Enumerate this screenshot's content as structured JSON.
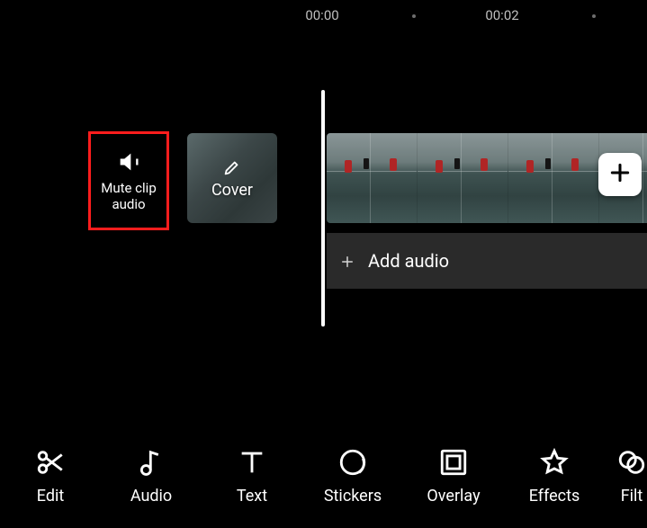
{
  "ruler": {
    "t0": "00:00",
    "t1": "00:02"
  },
  "tiles": {
    "mute_label": "Mute clip audio",
    "cover_label": "Cover"
  },
  "timeline": {
    "add_audio_label": "Add audio",
    "add_clip_icon": "plus-icon"
  },
  "toolbar": {
    "edit": "Edit",
    "audio": "Audio",
    "text": "Text",
    "stickers": "Stickers",
    "overlay": "Overlay",
    "effects": "Effects",
    "filters": "Filt"
  },
  "highlight": {
    "color": "#ff1d1d",
    "target": "mute-clip-audio"
  }
}
